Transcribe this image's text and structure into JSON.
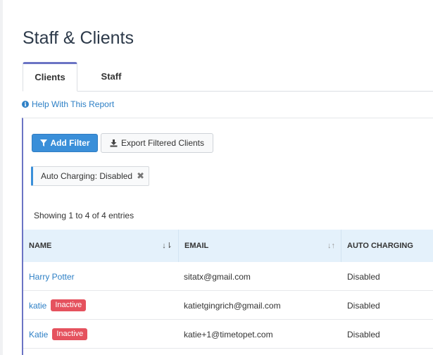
{
  "page": {
    "title": "Staff & Clients"
  },
  "tabs": [
    {
      "label": "Clients",
      "active": true
    },
    {
      "label": "Staff",
      "active": false
    }
  ],
  "help": {
    "icon": "info-circle-icon",
    "label": "Help With This Report"
  },
  "toolbar": {
    "add_filter_label": "Add Filter",
    "add_filter_icon": "filter-icon",
    "export_label": "Export Filtered Clients",
    "export_icon": "download-icon"
  },
  "filters": [
    {
      "label": "Auto Charging: Disabled",
      "remove_icon": "close-icon"
    }
  ],
  "table": {
    "summary": "Showing 1 to 4 of 4 entries",
    "columns": [
      {
        "label": "NAME",
        "sort": "ascending"
      },
      {
        "label": "EMAIL",
        "sort": "none"
      },
      {
        "label": "AUTO CHARGING",
        "sort": "none"
      }
    ],
    "rows": [
      {
        "name": "Harry Potter",
        "badge": "",
        "email": "sitatx@gmail.com",
        "auto_charging": "Disabled"
      },
      {
        "name": "katie",
        "badge": "Inactive",
        "email": "katietgingrich@gmail.com",
        "auto_charging": "Disabled"
      },
      {
        "name": "Katie",
        "badge": "Inactive",
        "email": "katie+1@timetopet.com",
        "auto_charging": "Disabled"
      }
    ]
  },
  "colors": {
    "accent": "#6b74c4",
    "primary_button": "#3a8fd9",
    "link": "#2e80c6",
    "badge_inactive": "#e5525e",
    "table_header_bg": "#e4f1fb"
  }
}
